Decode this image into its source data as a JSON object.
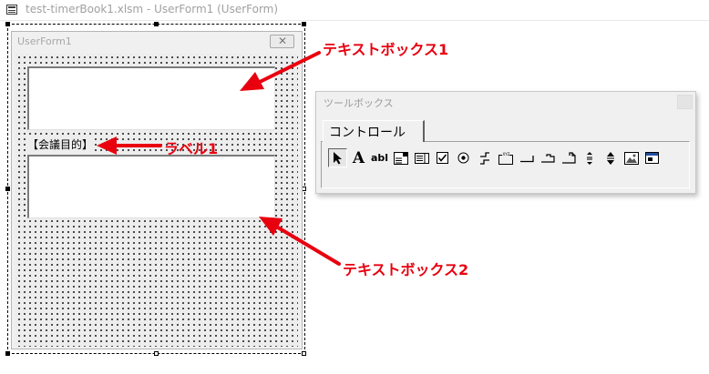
{
  "window": {
    "title": "test-timerBook1.xlsm - UserForm1 (UserForm)"
  },
  "userform": {
    "title": "UserForm1",
    "close_glyph": "✕",
    "label1_text": "【会議目的】"
  },
  "toolbox": {
    "title": "ツールボックス",
    "tab_label": "コントロール",
    "tools": [
      {
        "name": "select-objects-tool",
        "glyph": ""
      },
      {
        "name": "label-tool",
        "glyph": "A"
      },
      {
        "name": "textbox-tool",
        "glyph": "abl"
      },
      {
        "name": "combobox-tool",
        "glyph": ""
      },
      {
        "name": "listbox-tool",
        "glyph": ""
      },
      {
        "name": "checkbox-tool",
        "glyph": ""
      },
      {
        "name": "optionbutton-tool",
        "glyph": ""
      },
      {
        "name": "togglebutton-tool",
        "glyph": ""
      },
      {
        "name": "frame-tool",
        "glyph": ""
      },
      {
        "name": "commandbutton-tool",
        "glyph": ""
      },
      {
        "name": "tabstrip-tool",
        "glyph": ""
      },
      {
        "name": "multipage-tool",
        "glyph": ""
      },
      {
        "name": "scrollbar-tool",
        "glyph": ""
      },
      {
        "name": "spinbutton-tool",
        "glyph": ""
      },
      {
        "name": "image-tool",
        "glyph": ""
      },
      {
        "name": "refedit-tool",
        "glyph": ""
      }
    ]
  },
  "annotations": {
    "textbox1": "テキストボックス1",
    "label1": "ラベル1",
    "textbox2": "テキストボックス2",
    "color": "#e8000f"
  }
}
